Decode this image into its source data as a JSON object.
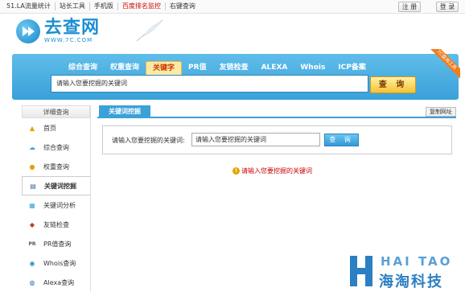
{
  "topbar": {
    "links": [
      "51.LA流量统计",
      "站长工具",
      "手机版",
      "百度排名监控",
      "右键查询"
    ],
    "register_label": "注 册",
    "login_label": "登 录"
  },
  "logo": {
    "name": "去查网",
    "url": "WWW.7C.COM"
  },
  "search": {
    "tabs": [
      "综合查询",
      "权重查询",
      "关键字",
      "PR值",
      "友链检查",
      "ALEXA",
      "Whois",
      "ICP备案"
    ],
    "active_tab": "关键字",
    "placeholder": "请输入您要挖掘的关键词",
    "button_label": "查 询",
    "ribbon_text": "7C查询工具"
  },
  "sidebar": {
    "title": "详细查询",
    "items": [
      {
        "label": "首页",
        "icon": "home-icon"
      },
      {
        "label": "综合查询",
        "icon": "cloud-icon"
      },
      {
        "label": "权重查询",
        "icon": "paw-icon"
      },
      {
        "label": "关键词挖掘",
        "icon": "document-icon"
      },
      {
        "label": "关键词分析",
        "icon": "analysis-icon"
      },
      {
        "label": "友链检查",
        "icon": "link-icon"
      },
      {
        "label": "PR值查询",
        "icon": "pr-icon"
      },
      {
        "label": "Whois查询",
        "icon": "whois-icon"
      },
      {
        "label": "Alexa查询",
        "icon": "alexa-icon"
      }
    ],
    "active_item": "关键词挖掘"
  },
  "main": {
    "tab_label": "关键词挖掘",
    "copy_label": "复制网址",
    "form_label": "请输入您要挖掘的关键词:",
    "input_placeholder": "请输入您要挖掘的关键词",
    "button_label": "查 询",
    "error_text": "请输入您要挖掘的关键词"
  },
  "watermark": {
    "en": "HAI TAO",
    "cn": "海淘科技"
  },
  "colors": {
    "accent": "#3aa1d9",
    "button": "#f6c232",
    "error": "#cc0000"
  }
}
